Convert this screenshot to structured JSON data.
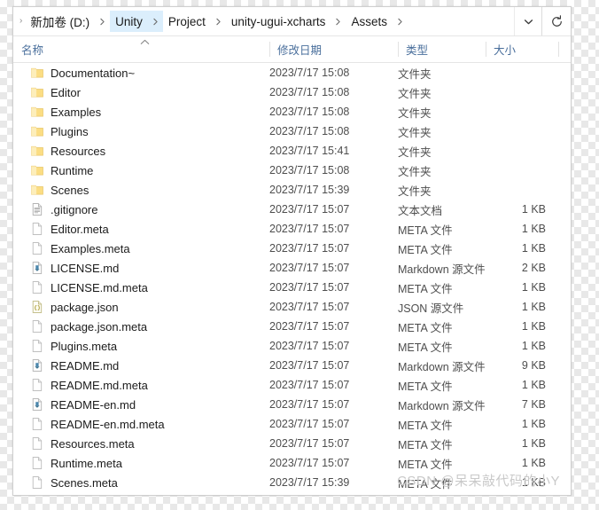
{
  "address_bar": {
    "crumbs": [
      {
        "label": "新加卷 (D:)",
        "highlighted": false
      },
      {
        "label": "Unity",
        "highlighted": true
      },
      {
        "label": "Project",
        "highlighted": false
      },
      {
        "label": "unity-ugui-xcharts",
        "highlighted": false
      },
      {
        "label": "Assets",
        "highlighted": false
      }
    ],
    "dropdown_icon": "chevron-down-icon",
    "refresh_icon": "refresh-icon"
  },
  "columns": {
    "name": "名称",
    "date_modified": "修改日期",
    "type": "类型",
    "size": "大小",
    "sort_indicator": "^"
  },
  "files": [
    {
      "name": "Documentation~",
      "date": "2023/7/17 15:08",
      "type": "文件夹",
      "size": "",
      "icon": "folder-icon"
    },
    {
      "name": "Editor",
      "date": "2023/7/17 15:08",
      "type": "文件夹",
      "size": "",
      "icon": "folder-icon"
    },
    {
      "name": "Examples",
      "date": "2023/7/17 15:08",
      "type": "文件夹",
      "size": "",
      "icon": "folder-icon"
    },
    {
      "name": "Plugins",
      "date": "2023/7/17 15:08",
      "type": "文件夹",
      "size": "",
      "icon": "folder-icon"
    },
    {
      "name": "Resources",
      "date": "2023/7/17 15:41",
      "type": "文件夹",
      "size": "",
      "icon": "folder-icon"
    },
    {
      "name": "Runtime",
      "date": "2023/7/17 15:08",
      "type": "文件夹",
      "size": "",
      "icon": "folder-icon"
    },
    {
      "name": "Scenes",
      "date": "2023/7/17 15:39",
      "type": "文件夹",
      "size": "",
      "icon": "folder-icon"
    },
    {
      "name": ".gitignore",
      "date": "2023/7/17 15:07",
      "type": "文本文档",
      "size": "1 KB",
      "icon": "text-document-icon"
    },
    {
      "name": "Editor.meta",
      "date": "2023/7/17 15:07",
      "type": "META 文件",
      "size": "1 KB",
      "icon": "blank-file-icon"
    },
    {
      "name": "Examples.meta",
      "date": "2023/7/17 15:07",
      "type": "META 文件",
      "size": "1 KB",
      "icon": "blank-file-icon"
    },
    {
      "name": "LICENSE.md",
      "date": "2023/7/17 15:07",
      "type": "Markdown 源文件",
      "size": "2 KB",
      "icon": "markdown-file-icon"
    },
    {
      "name": "LICENSE.md.meta",
      "date": "2023/7/17 15:07",
      "type": "META 文件",
      "size": "1 KB",
      "icon": "blank-file-icon"
    },
    {
      "name": "package.json",
      "date": "2023/7/17 15:07",
      "type": "JSON 源文件",
      "size": "1 KB",
      "icon": "json-file-icon"
    },
    {
      "name": "package.json.meta",
      "date": "2023/7/17 15:07",
      "type": "META 文件",
      "size": "1 KB",
      "icon": "blank-file-icon"
    },
    {
      "name": "Plugins.meta",
      "date": "2023/7/17 15:07",
      "type": "META 文件",
      "size": "1 KB",
      "icon": "blank-file-icon"
    },
    {
      "name": "README.md",
      "date": "2023/7/17 15:07",
      "type": "Markdown 源文件",
      "size": "9 KB",
      "icon": "markdown-file-icon"
    },
    {
      "name": "README.md.meta",
      "date": "2023/7/17 15:07",
      "type": "META 文件",
      "size": "1 KB",
      "icon": "blank-file-icon"
    },
    {
      "name": "README-en.md",
      "date": "2023/7/17 15:07",
      "type": "Markdown 源文件",
      "size": "7 KB",
      "icon": "markdown-file-icon"
    },
    {
      "name": "README-en.md.meta",
      "date": "2023/7/17 15:07",
      "type": "META 文件",
      "size": "1 KB",
      "icon": "blank-file-icon"
    },
    {
      "name": "Resources.meta",
      "date": "2023/7/17 15:07",
      "type": "META 文件",
      "size": "1 KB",
      "icon": "blank-file-icon"
    },
    {
      "name": "Runtime.meta",
      "date": "2023/7/17 15:07",
      "type": "META 文件",
      "size": "1 KB",
      "icon": "blank-file-icon"
    },
    {
      "name": "Scenes.meta",
      "date": "2023/7/17 15:39",
      "type": "META 文件",
      "size": "1 KB",
      "icon": "blank-file-icon"
    }
  ],
  "watermark": "CSDN @呆呆敲代码的小Y",
  "colors": {
    "folder": "#fce08c",
    "header_text": "#4a6f9c",
    "crumb_highlight": "#dbeefc",
    "markdown_marker": "#3f7fa8",
    "json_marker": "#b2a23c"
  }
}
